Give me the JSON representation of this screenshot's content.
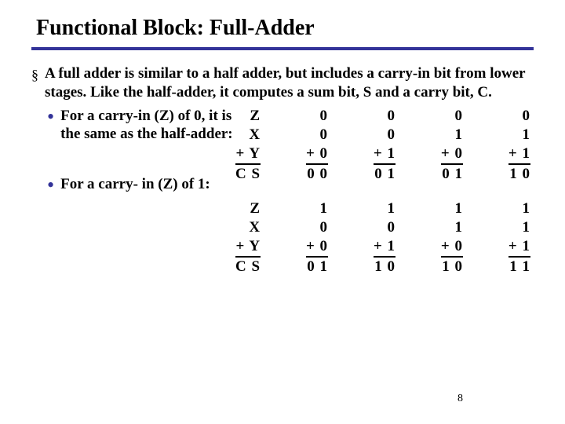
{
  "title": "Functional Block: Full-Adder",
  "main_text": "A full adder is similar to a half adder, but includes a carry-in bit from lower stages.   Like the half-adder, it computes a sum bit, S and a carry bit, C.",
  "sub1": "For a carry-in (Z) of 0, it is the same as the half-adder:",
  "sub2": "For a carry- in (Z) of 1:",
  "labels": {
    "z": "Z",
    "x": "X",
    "py": "+ Y",
    "cs": "C S"
  },
  "t0": {
    "c0": {
      "z": "0",
      "x": "0",
      "py": "+ 0",
      "cs": "0 0"
    },
    "c1": {
      "z": "0",
      "x": "0",
      "py": "+ 1",
      "cs": "0 1"
    },
    "c2": {
      "z": "0",
      "x": "1",
      "py": "+ 0",
      "cs": "0 1"
    },
    "c3": {
      "z": "0",
      "x": "1",
      "py": "+ 1",
      "cs": "1 0"
    }
  },
  "t1": {
    "c0": {
      "z": "1",
      "x": "0",
      "py": "+ 0",
      "cs": "0 1"
    },
    "c1": {
      "z": "1",
      "x": "0",
      "py": "+ 1",
      "cs": "1 0"
    },
    "c2": {
      "z": "1",
      "x": "1",
      "py": "+ 0",
      "cs": "1 0"
    },
    "c3": {
      "z": "1",
      "x": "1",
      "py": "+ 1",
      "cs": "1 1"
    }
  },
  "page": "8"
}
